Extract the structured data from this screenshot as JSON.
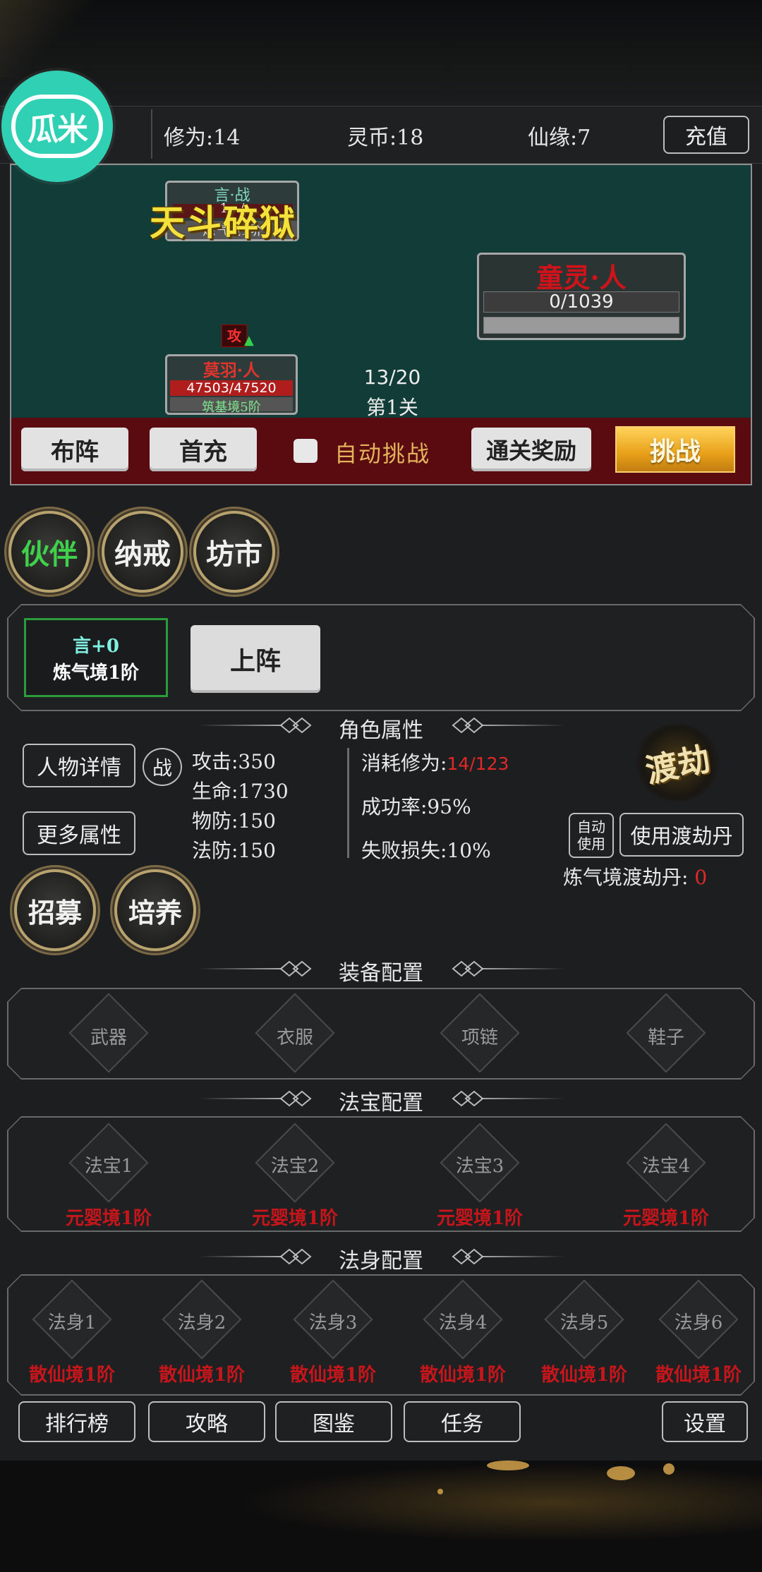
{
  "logo": {
    "text": "瓜米"
  },
  "topbar": {
    "cultivation": "修为:14",
    "spirit_coins": "灵币:18",
    "immortal_fate": "仙缘:7",
    "recharge_label": "充值"
  },
  "battle": {
    "skill_name": "天斗碎狱",
    "ally_top": {
      "name": "言·战",
      "hp": "1.../",
      "realm": "炼气境1阶"
    },
    "ally_bottom": {
      "badge": "攻",
      "name": "莫羽·人",
      "hp": "47503/47520",
      "realm": "筑基境5阶",
      "hp_fraction": 0.9996
    },
    "enemy": {
      "name": "童灵·人",
      "hp": "0/1039",
      "hp_fraction": 0
    },
    "progress": "13/20",
    "stage": "第1关",
    "buttons": {
      "formation": "布阵",
      "first_recharge": "首充",
      "auto_challenge": "自动挑战",
      "clear_reward": "通关奖励",
      "challenge": "挑战"
    },
    "auto_checked": false
  },
  "nav_round": [
    "伙伴",
    "纳戒",
    "坊市"
  ],
  "partner": {
    "name": "言+0",
    "realm": "炼气境1阶",
    "deploy_label": "上阵"
  },
  "attributes": {
    "title": "角色属性",
    "details_button": "人物详情",
    "battle_button": "战",
    "more_button": "更多属性",
    "attack": "攻击:350",
    "life": "生命:1730",
    "phys_def": "物防:150",
    "magic_def": "法防:150",
    "cost_label": "消耗修为:",
    "cost_value": "14/123",
    "success_rate": "成功率:95%",
    "fail_loss": "失败损失:10%",
    "tribulation_emblem": "渡劫",
    "auto_use": "自动使用",
    "use_pill": "使用渡劫丹",
    "pill_label": "炼气境渡劫丹:",
    "pill_count": "0"
  },
  "actions": [
    "招募",
    "培养"
  ],
  "equipment": {
    "title": "装备配置",
    "slots": [
      "武器",
      "衣服",
      "项链",
      "鞋子"
    ]
  },
  "treasures": {
    "title": "法宝配置",
    "slots": [
      {
        "name": "法宝1",
        "realm": "元婴境1阶"
      },
      {
        "name": "法宝2",
        "realm": "元婴境1阶"
      },
      {
        "name": "法宝3",
        "realm": "元婴境1阶"
      },
      {
        "name": "法宝4",
        "realm": "元婴境1阶"
      }
    ]
  },
  "bodies": {
    "title": "法身配置",
    "slots": [
      {
        "name": "法身1",
        "realm": "散仙境1阶"
      },
      {
        "name": "法身2",
        "realm": "散仙境1阶"
      },
      {
        "name": "法身3",
        "realm": "散仙境1阶"
      },
      {
        "name": "法身4",
        "realm": "散仙境1阶"
      },
      {
        "name": "法身5",
        "realm": "散仙境1阶"
      },
      {
        "name": "法身6",
        "realm": "散仙境1阶"
      }
    ]
  },
  "bottom_nav": [
    "排行榜",
    "攻略",
    "图鉴",
    "任务",
    "设置"
  ],
  "colors": {
    "battle_bg": "#123c37",
    "strip_bg": "#5a0b0f",
    "realm_red": "#c7161b",
    "partner_green": "#2a9c3a",
    "gold": "#e8a019"
  }
}
